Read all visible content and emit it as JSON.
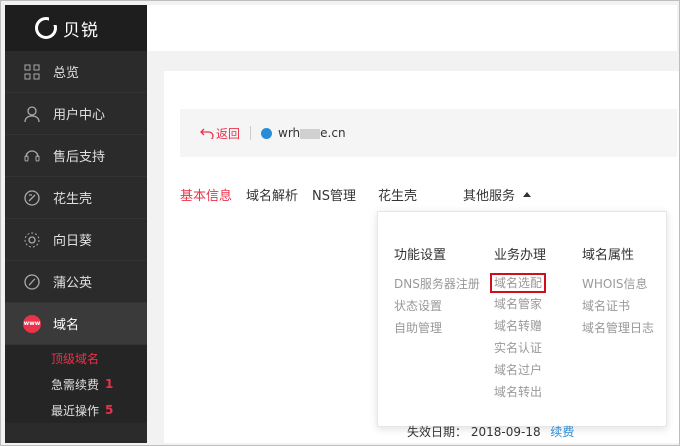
{
  "brand": {
    "name": "贝锐"
  },
  "sidebar": {
    "items": [
      {
        "label": "总览",
        "icon": "grid-icon"
      },
      {
        "label": "用户中心",
        "icon": "user-icon"
      },
      {
        "label": "售后支持",
        "icon": "support-icon"
      },
      {
        "label": "花生壳",
        "icon": "peanut-icon"
      },
      {
        "label": "向日葵",
        "icon": "sunflower-icon"
      },
      {
        "label": "蒲公英",
        "icon": "dandelion-icon"
      },
      {
        "label": "域名",
        "icon": "www-icon"
      }
    ],
    "www_badge": "www",
    "sub_items": [
      {
        "label": "顶级域名"
      },
      {
        "label": "急需续费",
        "count": "1"
      },
      {
        "label": "最近操作",
        "count": "5"
      }
    ]
  },
  "back_bar": {
    "back_label": "返回",
    "domain_prefix": "wrh",
    "domain_suffix": "e.cn"
  },
  "tabs": {
    "basic": "基本信息",
    "dns": "域名解析",
    "ns": "NS管理",
    "peanut": "花生壳",
    "other": "其他服务"
  },
  "dropdown": {
    "col1": {
      "title": "功能设置",
      "links": [
        "DNS服务器注册",
        "状态设置",
        "自助管理"
      ]
    },
    "col2": {
      "title": "业务办理",
      "links": [
        "域名选配",
        "域名管家",
        "域名转赠",
        "实名认证",
        "域名过户",
        "域名转出"
      ]
    },
    "col3": {
      "title": "域名属性",
      "links": [
        "WHOIS信息",
        "域名证书",
        "域名管理日志"
      ]
    }
  },
  "expire": {
    "label": "失效日期：",
    "date": "2018-09-18",
    "renew": "续费"
  },
  "colors": {
    "accent": "#e8334a",
    "sidebar_bg": "#2b2b2b",
    "link_blue": "#2a8cd6",
    "highlight_border": "#d10f1b"
  }
}
